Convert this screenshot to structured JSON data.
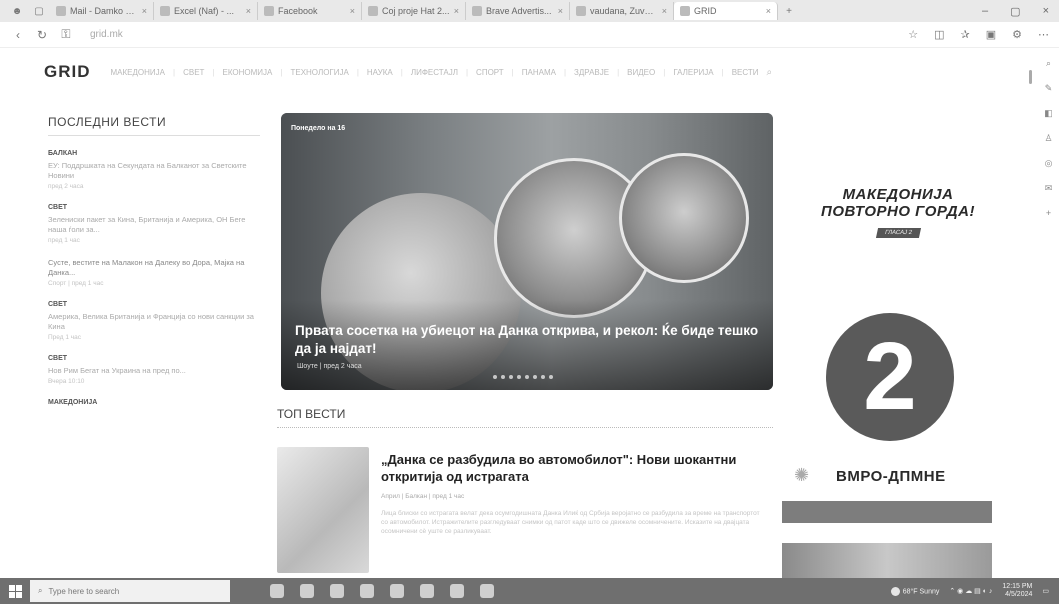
{
  "browser": {
    "tabs": [
      {
        "label": "Mail - Damko Gi..."
      },
      {
        "label": "Excel (Naf) - ..."
      },
      {
        "label": "Facebook"
      },
      {
        "label": "Сој proje Hat 2..."
      },
      {
        "label": "Brave Advertis..."
      },
      {
        "label": "vaudana, Zuvete..."
      },
      {
        "label": "GRID"
      }
    ],
    "url": "grid.mk"
  },
  "site": {
    "logo": "GRID",
    "menu": [
      "МАКЕДОНИЈА",
      "СВЕТ",
      "ЕКОНОМИЈА",
      "ТЕХНОЛОГИЈА",
      "НАУКА",
      "ЛИФЕСТАЈЛ",
      "СПОРТ",
      "ПАНАМА",
      "ЗДРАВЈЕ",
      "ВИДЕО",
      "ГАЛЕРИЈА",
      "ВЕСТИ"
    ]
  },
  "latest": {
    "heading": "ПОСЛЕДНИ ВЕСТИ",
    "items": [
      {
        "category": "БАЛКАН",
        "title": "ЕУ: Поддршката на Сeкундата на Балканот за Светските Новини",
        "meta": "пред 2 часа"
      },
      {
        "category": "СВЕТ",
        "title": "Зелениски пакет за Кина, Британија и Америка, ОН Беге наша ѓоли за...",
        "meta": "пред 1 час"
      },
      {
        "category": "",
        "title": "Сусте, вестите на Малакон на Далеку во Дора, Мајка на Данка...",
        "meta": "Спорт | пред 1 час"
      },
      {
        "category": "СВЕТ",
        "title": "Америка, Велика Британија и Франција со нови санкции за Кина",
        "meta": "Пред 1 час"
      },
      {
        "category": "СВЕТ",
        "title": "Нов Рим Бегат на Украина на пред по...",
        "meta": "Вчера 10:10"
      },
      {
        "category": "МАКЕДОНИЈА",
        "title": "",
        "meta": ""
      }
    ]
  },
  "hero": {
    "tag": "Понедело на 16",
    "title": "Првата сосетка на убиецот на Данка открива, и рекол: Ќе биде тешко да ја најдат!",
    "meta": "Шоуте | пред 2 часа",
    "slides": 8
  },
  "top": {
    "heading": "ТОП ВЕСТИ",
    "title": "„Данка се разбудила во автомобилот\": Нови шокантни откритија од истрагата",
    "meta": "Април | Балкан | пред 1 час",
    "desc": "Лица блиски со истрагата велат дека осумгодишната Данка Илиќ од Србија веројатно се разбудила за време на транспортот со автомобилот. Истражителите разгледуваат снимки од патот каде што се движеле осомничените. Исказите на двајцата осомничени сè уште се разликуваат."
  },
  "ads": {
    "ad1_line1": "МАКЕДОНИЈА",
    "ad1_line2": "ПОВТОРНО ГОРДА!",
    "ad1_badge": "ГЛАСАЈ 2",
    "ad2_number": "2",
    "ad2_text": "ВМРО-ДПМНЕ"
  },
  "taskbar": {
    "search": "Type here to search",
    "weather": "68°F  Sunny",
    "time": "12:15 PM",
    "date": "4/5/2024"
  }
}
